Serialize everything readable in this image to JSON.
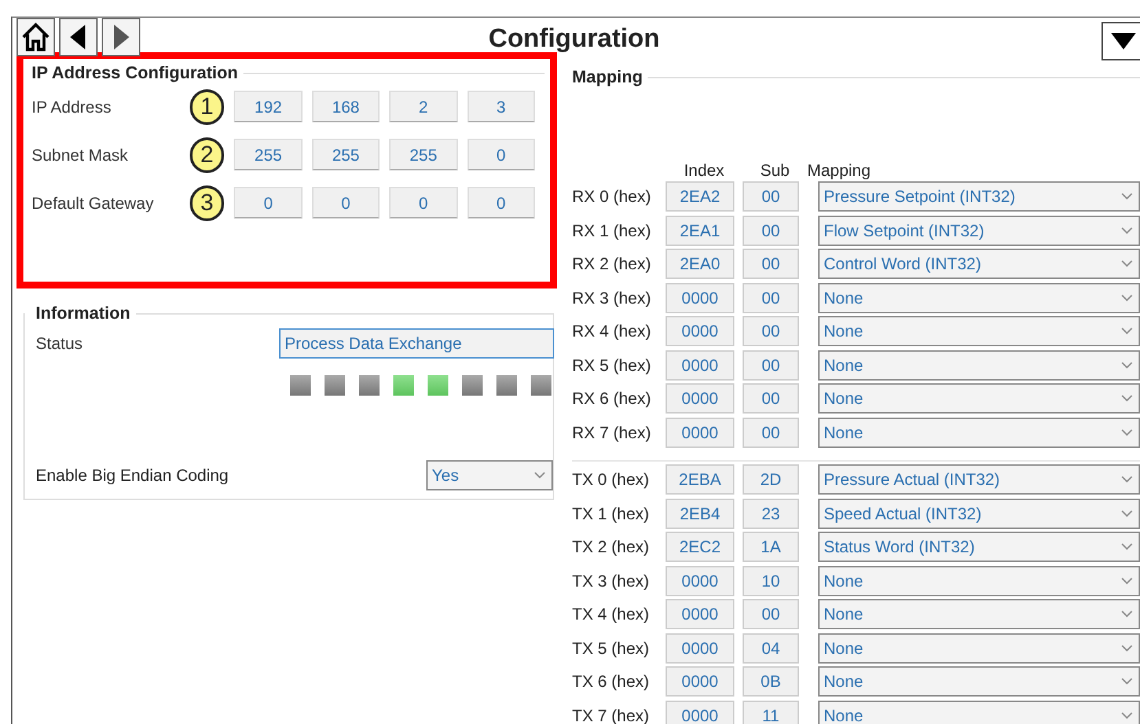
{
  "window": {
    "title": "Configuration"
  },
  "ip_config": {
    "title": "IP Address Configuration",
    "highlighted": true,
    "rows": [
      {
        "label": "IP Address",
        "callout": "1",
        "octets": [
          "192",
          "168",
          "2",
          "3"
        ]
      },
      {
        "label": "Subnet Mask",
        "callout": "2",
        "octets": [
          "255",
          "255",
          "255",
          "0"
        ]
      },
      {
        "label": "Default Gateway",
        "callout": "3",
        "octets": [
          "0",
          "0",
          "0",
          "0"
        ]
      }
    ]
  },
  "information": {
    "title": "Information",
    "status_label": "Status",
    "status_value": "Process Data Exchange",
    "leds": [
      {
        "on": false
      },
      {
        "on": false
      },
      {
        "on": false
      },
      {
        "on": true
      },
      {
        "on": true
      },
      {
        "on": false
      },
      {
        "on": false
      },
      {
        "on": false
      }
    ],
    "big_endian_label": "Enable Big Endian Coding",
    "big_endian_value": "Yes"
  },
  "mapping": {
    "title": "Mapping",
    "columns": [
      "Index",
      "Sub",
      "Mapping"
    ],
    "rx": [
      {
        "label": "RX 0 (hex)",
        "index": "2EA2",
        "sub": "00",
        "mapping": "Pressure Setpoint (INT32)"
      },
      {
        "label": "RX 1 (hex)",
        "index": "2EA1",
        "sub": "00",
        "mapping": "Flow Setpoint (INT32)"
      },
      {
        "label": "RX 2 (hex)",
        "index": "2EA0",
        "sub": "00",
        "mapping": "Control Word (INT32)"
      },
      {
        "label": "RX 3 (hex)",
        "index": "0000",
        "sub": "00",
        "mapping": "None"
      },
      {
        "label": "RX 4 (hex)",
        "index": "0000",
        "sub": "00",
        "mapping": "None"
      },
      {
        "label": "RX 5 (hex)",
        "index": "0000",
        "sub": "00",
        "mapping": "None"
      },
      {
        "label": "RX 6 (hex)",
        "index": "0000",
        "sub": "00",
        "mapping": "None"
      },
      {
        "label": "RX 7 (hex)",
        "index": "0000",
        "sub": "00",
        "mapping": "None"
      }
    ],
    "tx": [
      {
        "label": "TX 0 (hex)",
        "index": "2EBA",
        "sub": "2D",
        "mapping": "Pressure Actual (INT32)"
      },
      {
        "label": "TX 1 (hex)",
        "index": "2EB4",
        "sub": "23",
        "mapping": "Speed Actual (INT32)"
      },
      {
        "label": "TX 2 (hex)",
        "index": "2EC2",
        "sub": "1A",
        "mapping": "Status Word (INT32)"
      },
      {
        "label": "TX 3 (hex)",
        "index": "0000",
        "sub": "10",
        "mapping": "None"
      },
      {
        "label": "TX 4 (hex)",
        "index": "0000",
        "sub": "00",
        "mapping": "None"
      },
      {
        "label": "TX 5 (hex)",
        "index": "0000",
        "sub": "04",
        "mapping": "None"
      },
      {
        "label": "TX 6 (hex)",
        "index": "0000",
        "sub": "0B",
        "mapping": "None"
      },
      {
        "label": "TX 7 (hex)",
        "index": "0000",
        "sub": "11",
        "mapping": "None"
      }
    ]
  }
}
